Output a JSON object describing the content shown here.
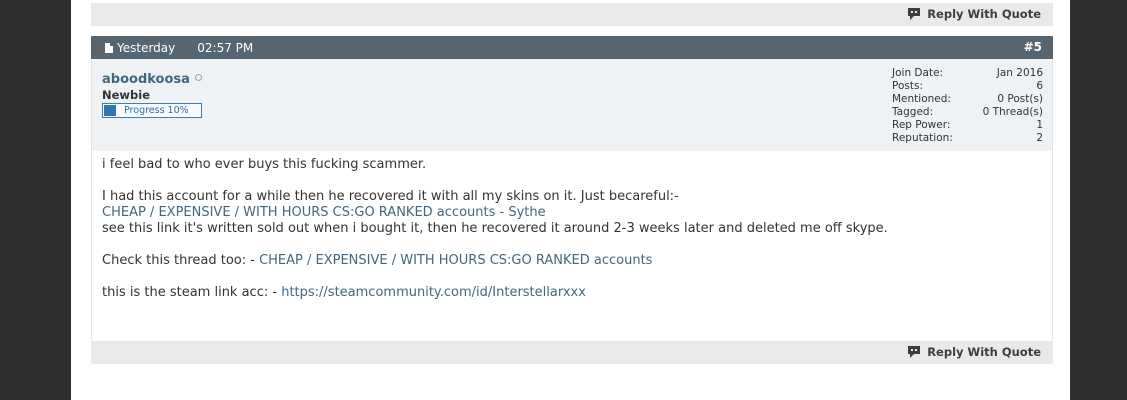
{
  "reply_label": "Reply With Quote",
  "post": {
    "date": "Yesterday",
    "time": "02:57 PM",
    "number": "#5"
  },
  "user": {
    "name": "aboodkoosa",
    "title": "Newbie",
    "rank_label": "Progress 10%",
    "rank_progress": 0.1
  },
  "stats": [
    {
      "label": "Join Date:",
      "value": "Jan 2016"
    },
    {
      "label": "Posts:",
      "value": "6"
    },
    {
      "label": "Mentioned:",
      "value": "0 Post(s)"
    },
    {
      "label": "Tagged:",
      "value": "0 Thread(s)"
    },
    {
      "label": "Rep Power:",
      "value": "1"
    },
    {
      "label": "Reputation:",
      "value": "2"
    }
  ],
  "message": {
    "line1": "i feel bad to who ever buys this fucking scammer.",
    "line2": "I had this account for a while then he recovered it with all my skins on it. Just becareful:-",
    "link1": "CHEAP / EXPENSIVE / WITH HOURS CS:GO RANKED accounts - Sythe",
    "line3": "see this link it's written sold out when i bought it, then he recovered it around 2-3 weeks later and deleted me off skype.",
    "line4_prefix": "Check this thread too: - ",
    "link2": "CHEAP / EXPENSIVE / WITH HOURS CS:GO RANKED accounts",
    "line5_prefix": "this is the steam link acc: - ",
    "link3": "https://steamcommunity.com/id/Interstellarxxx"
  },
  "colors": {
    "post_header": "#56656f",
    "link": "#41677f",
    "userinfo_bg": "#eef2f5",
    "side_bg": "#2e2f31"
  }
}
